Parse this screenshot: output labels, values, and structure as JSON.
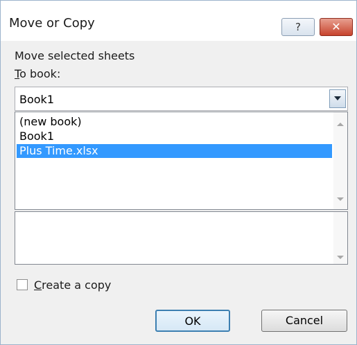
{
  "window": {
    "title": "Move or Copy",
    "help_label": "?",
    "close_label": "✕"
  },
  "section_label": "Move selected sheets",
  "to_book": {
    "label": "To book:",
    "selected_value": "Book1"
  },
  "book_list": {
    "items": [
      "(new book)",
      "Book1",
      "Plus Time.xlsx"
    ],
    "selected_index": 2
  },
  "create_copy": {
    "label": "Create a copy",
    "checked": false
  },
  "buttons": {
    "ok_label": "OK",
    "cancel_label": "Cancel"
  },
  "colors": {
    "selection": "#3399ff",
    "close_button": "#c7432d"
  }
}
